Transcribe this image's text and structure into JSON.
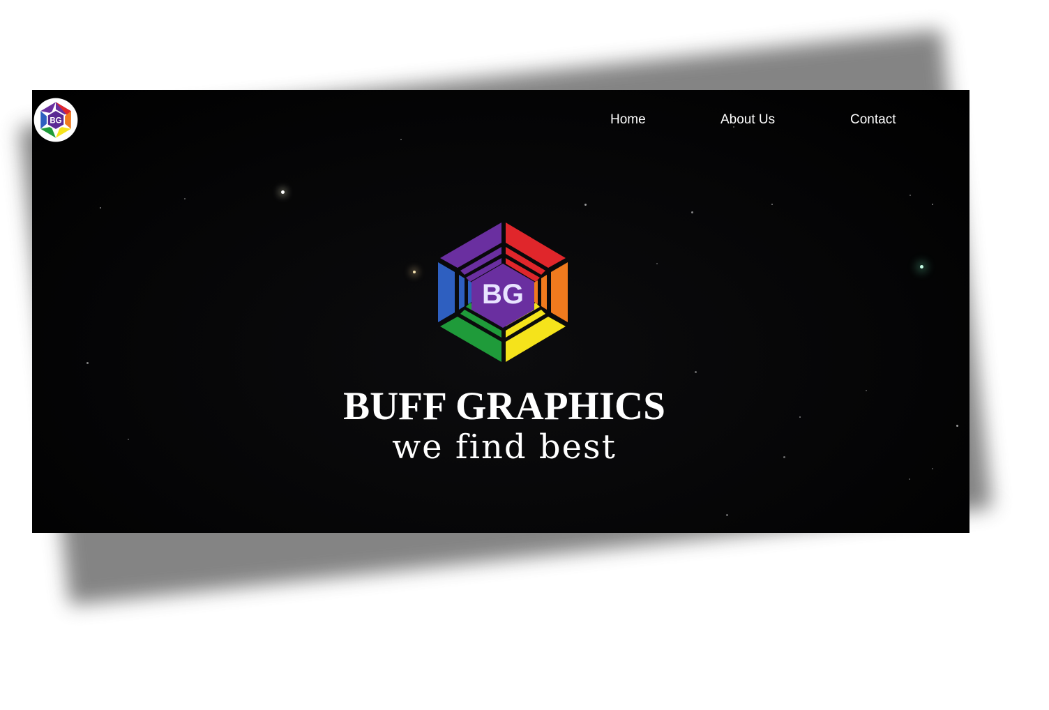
{
  "navbar": {
    "logo_icon": "bg-hexagon-logo-icon",
    "links": [
      {
        "label": "Home"
      },
      {
        "label": "About Us"
      },
      {
        "label": "Contact"
      }
    ]
  },
  "hero": {
    "logo_icon": "bg-hexagon-logo-icon",
    "logo_text": "BG",
    "title": "BUFF GRAPHICS",
    "tagline": "we find best"
  },
  "colors": {
    "background": "#000000",
    "text": "#ffffff",
    "logo_purple": "#6a2fa0",
    "logo_red": "#e0262b",
    "logo_orange": "#f07a1e",
    "logo_yellow": "#f5e31b",
    "logo_green": "#1f9b3a",
    "logo_blue": "#2e5fc0"
  }
}
